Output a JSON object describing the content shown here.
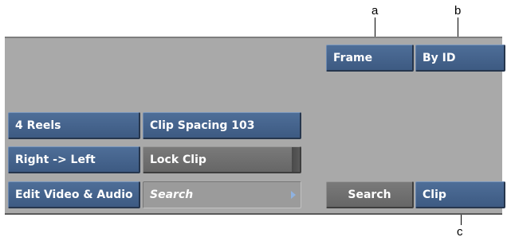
{
  "callouts": {
    "a": "a",
    "b": "b",
    "c": "c"
  },
  "panel": {
    "frame_button": "Frame",
    "by_id_button": "By ID",
    "reels_button": "4 Reels",
    "clip_spacing_button": "Clip Spacing 103",
    "direction_button": "Right -> Left",
    "lock_clip_button": "Lock Clip",
    "edit_mode_button": "Edit Video & Audio",
    "search_field": "Search",
    "search_button": "Search",
    "clip_button": "Clip"
  }
}
